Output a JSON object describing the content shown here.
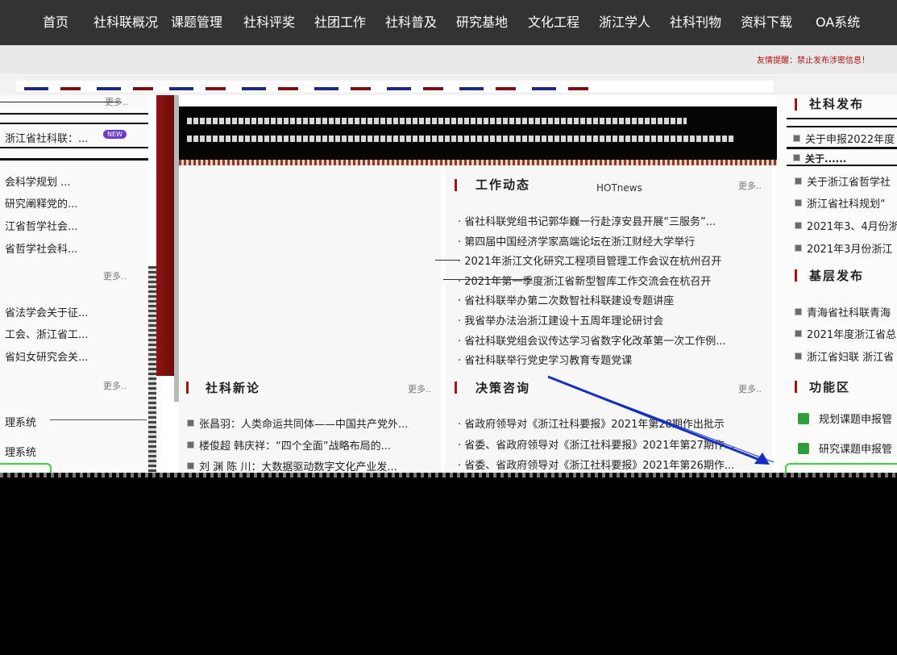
{
  "nav": [
    "首页",
    "社科联概况",
    "课题管理",
    "社科评奖",
    "社团工作",
    "社科普及",
    "研究基地",
    "文化工程",
    "浙江学人",
    "社科刊物",
    "资料下载",
    "OA系统"
  ],
  "notice": "友情提醒：禁止发布涉密信息！",
  "left": {
    "more1": "更多..",
    "item0": "浙江省社科联：...",
    "new_badge": "NEW",
    "items1": [
      "会科学规划 ...",
      "研究阐释党的...",
      "江省哲学社会...",
      "省哲学社会科..."
    ],
    "more2": "更多..",
    "items2": [
      "省法学会关于征...",
      "工会、浙江省工...",
      "省妇女研究会关..."
    ],
    "more3": "更多..",
    "systems": [
      "理系统",
      "理系统"
    ]
  },
  "work": {
    "title": "工作动态",
    "hot": "HOTnews",
    "more": "更多..",
    "items": [
      "省社科联党组书记郭华巍一行赴淳安县开展“三服务”...",
      "第四届中国经济学家高端论坛在浙江财经大学举行",
      "2021年浙江文化研究工程项目管理工作会议在杭州召开",
      "2021年第一季度浙江省新型智库工作交流会在杭召开",
      "省社科联举办第二次数智社科联建设专题讲座",
      "我省举办法治浙江建设十五周年理论研讨会",
      "省社科联党组会议传达学习省数字化改革第一次工作例...",
      "省社科联举行党史学习教育专题党课"
    ]
  },
  "xinlun": {
    "title": "社科新论",
    "more": "更多..",
    "items": [
      "张昌羽：人类命运共同体——中国共产党外...",
      "楼俊超 韩庆祥：“四个全面”战略布局的...",
      "刘 渊 陈 川：大数据驱动数字文化产业发..."
    ]
  },
  "juece": {
    "title": "决策咨询",
    "more": "更多..",
    "items": [
      "省政府领导对《浙江社科要报》2021年第28期作出批示",
      "省委、省政府领导对《浙江社科要报》2021年第27期作...",
      "省委、省政府领导对《浙江社科要报》2021年第26期作..."
    ]
  },
  "right": {
    "title1": "社科发布",
    "top_items": [
      "关于申报2022年度",
      "关于......"
    ],
    "items1": [
      "关于浙江省哲学社",
      "浙江省社科规划“",
      "2021年3、4月份浙",
      "2021年3月份浙江"
    ],
    "title2": "基层发布",
    "items2": [
      "青海省社科联青海",
      "2021年度浙江省总",
      "浙江省妇联 浙江省"
    ],
    "title3": "功能区",
    "func": [
      "规划课题申报管",
      "研究课题申报管"
    ]
  }
}
